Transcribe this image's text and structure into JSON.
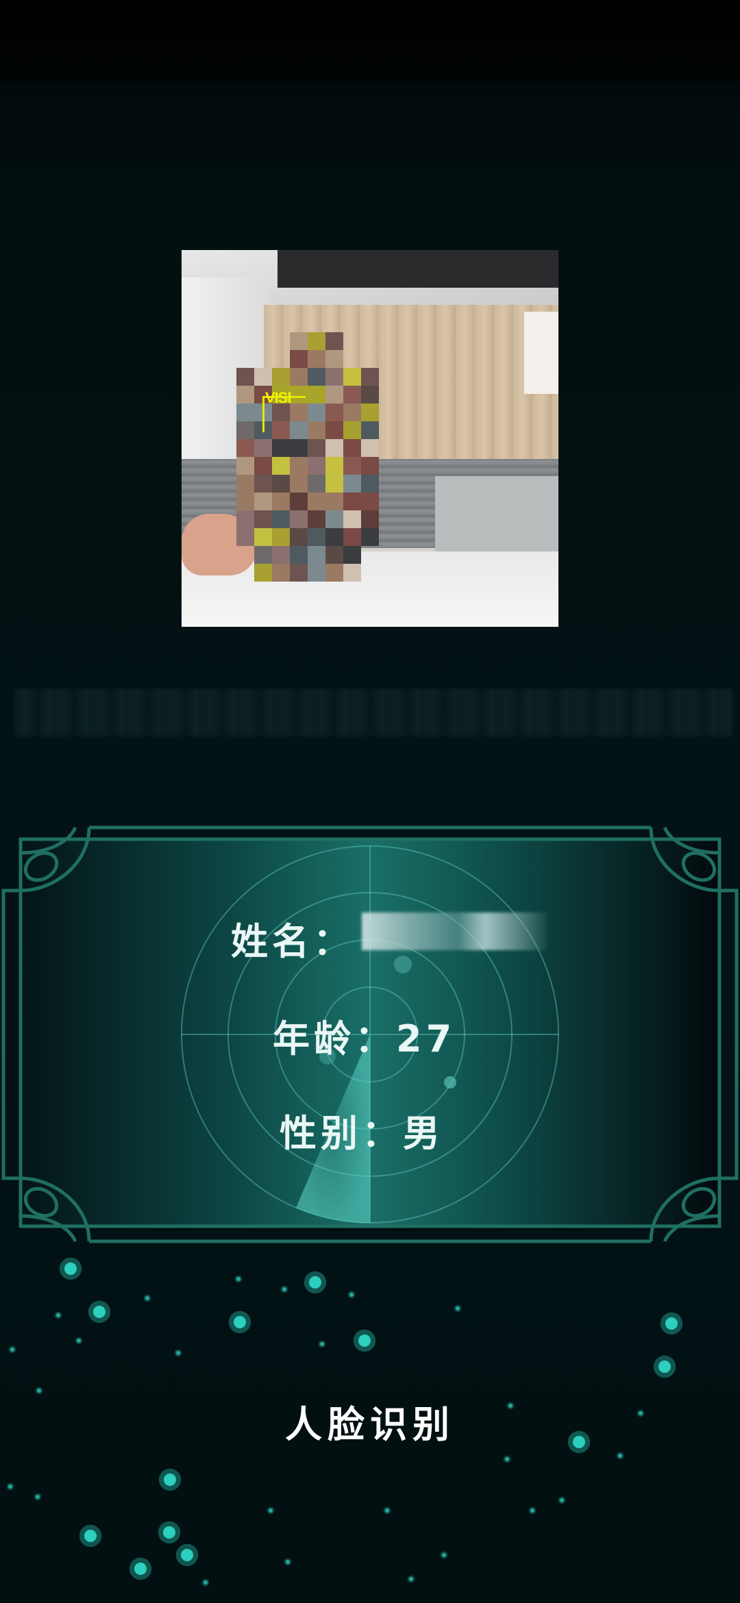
{
  "camera": {
    "face_tag": "VISI"
  },
  "panel": {
    "name_label": "姓名：",
    "age_label": "年龄：",
    "age_value": "27",
    "gender_label": "性别：",
    "gender_value": "男"
  },
  "title": "人脸识别",
  "colors": {
    "accent": "#2fd6c4",
    "panel_frame": "#1f6f62",
    "face_box": "#e6e600",
    "text": "#e9f7f5"
  },
  "icons": [
    "radar-icon",
    "sparkle-icon"
  ]
}
